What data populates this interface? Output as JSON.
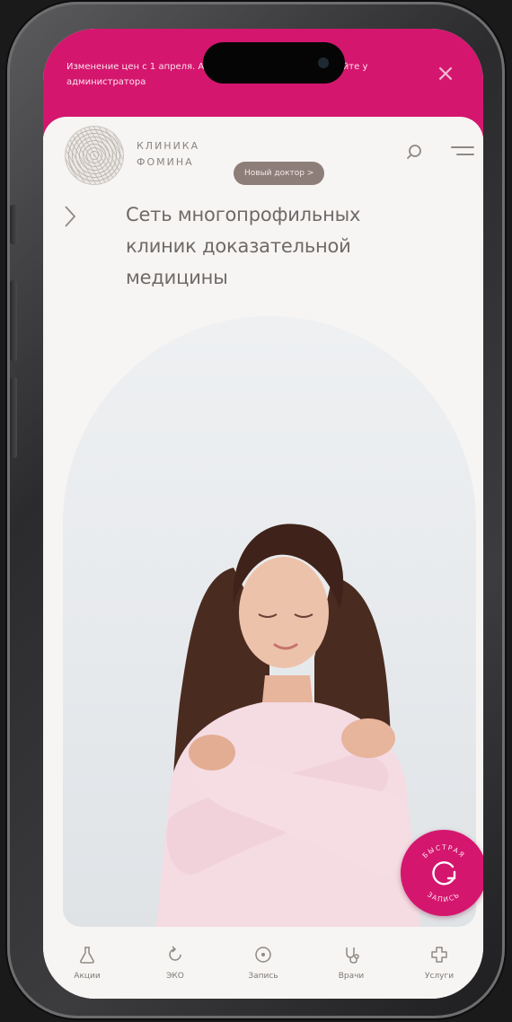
{
  "banner": {
    "text": "Изменение цен с 1 апреля. Актуальную стоимость уточняйте у администратора",
    "close_icon": "close-icon",
    "color": "#d4166e"
  },
  "header": {
    "logo_line1": "КЛИНИКА",
    "logo_line2": "ФОМИНА",
    "badge": "Новый доктор >",
    "search_icon": "search-icon",
    "menu_icon": "menu-icon"
  },
  "hero": {
    "headline_line1": "Сеть многопрофильных",
    "headline_line2": "клиник доказательной",
    "headline_line3": "медицины",
    "back_icon": "chevron-left-icon"
  },
  "quick_button": {
    "top_text": "БЫСТРАЯ",
    "bottom_text": "ЗАПИСЬ",
    "icon": "refresh-arrow-icon"
  },
  "tabbar": {
    "tabs": [
      {
        "label": "Акции",
        "icon": "flask-icon"
      },
      {
        "label": "ЭКО",
        "icon": "cycle-icon"
      },
      {
        "label": "Запись",
        "icon": "record-circle-icon"
      },
      {
        "label": "Врачи",
        "icon": "stethoscope-icon"
      },
      {
        "label": "Услуги",
        "icon": "medical-cross-icon"
      }
    ]
  },
  "colors": {
    "accent": "#d4166e",
    "background": "#f7f5f3",
    "text": "#6f6a67"
  }
}
